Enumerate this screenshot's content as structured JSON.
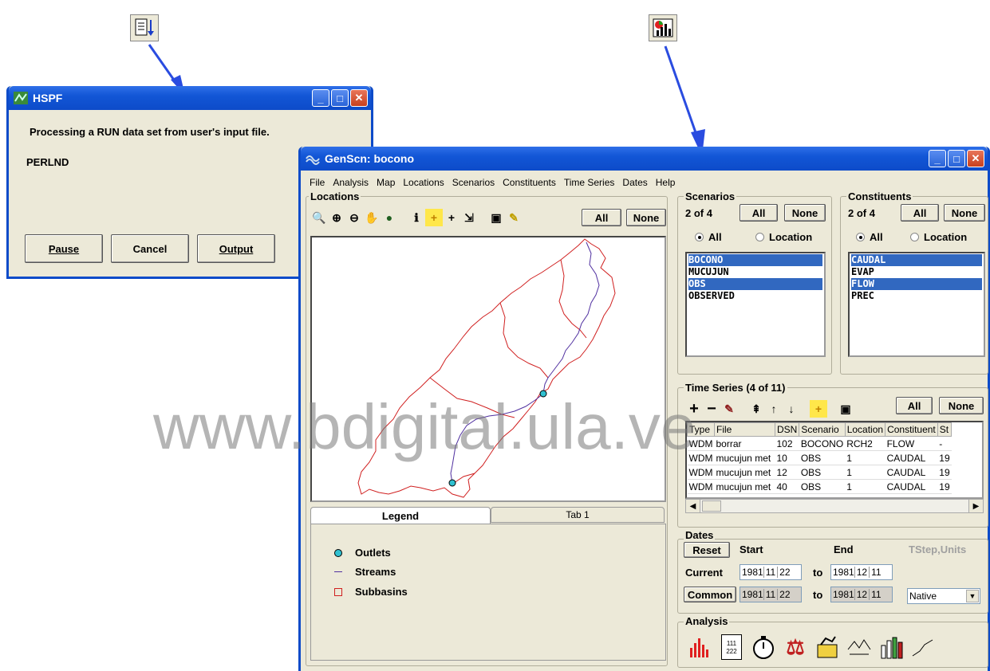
{
  "hspf": {
    "title": "HSPF",
    "message": "Processing a RUN data set from user's input file.",
    "section": "PERLND",
    "buttons": {
      "pause": "Pause",
      "cancel": "Cancel",
      "output": "Output"
    }
  },
  "watermark": "www.bdigital.ula.ve",
  "genscn": {
    "title": "GenScn: bocono",
    "menu": [
      "File",
      "Analysis",
      "Map",
      "Locations",
      "Scenarios",
      "Constituents",
      "Time Series",
      "Dates",
      "Help"
    ],
    "locations": {
      "label": "Locations",
      "all_label": "All",
      "none_label": "None"
    },
    "legend": {
      "tab_legend": "Legend",
      "tab_1": "Tab 1",
      "items": [
        {
          "label": "Outlets"
        },
        {
          "label": "Streams"
        },
        {
          "label": "Subbasins"
        }
      ]
    },
    "scenarios": {
      "label": "Scenarios",
      "count": "2 of 4",
      "all_label": "All",
      "none_label": "None",
      "radio_all": "All",
      "radio_location": "Location",
      "items": [
        {
          "name": "BOCONO",
          "selected": true
        },
        {
          "name": "MUCUJUN",
          "selected": false
        },
        {
          "name": "OBS",
          "selected": true
        },
        {
          "name": "OBSERVED",
          "selected": false
        }
      ]
    },
    "constituents": {
      "label": "Constituents",
      "count": "2 of 4",
      "all_label": "All",
      "none_label": "None",
      "radio_all": "All",
      "radio_location": "Location",
      "items": [
        {
          "name": "CAUDAL",
          "selected": true
        },
        {
          "name": "EVAP",
          "selected": false
        },
        {
          "name": "FLOW",
          "selected": true
        },
        {
          "name": "PREC",
          "selected": false
        }
      ]
    },
    "timeseries": {
      "label": "Time Series (4 of 11)",
      "all_label": "All",
      "none_label": "None",
      "columns": [
        "Type",
        "File",
        "DSN",
        "Scenario",
        "Location",
        "Constituent",
        "St"
      ],
      "rows": [
        [
          "WDM",
          "borrar",
          "102",
          "BOCONO",
          "RCH2",
          "FLOW",
          "-"
        ],
        [
          "WDM",
          "mucujun met",
          "10",
          "OBS",
          "1",
          "CAUDAL",
          "19"
        ],
        [
          "WDM",
          "mucujun met",
          "12",
          "OBS",
          "1",
          "CAUDAL",
          "19"
        ],
        [
          "WDM",
          "mucujun met",
          "40",
          "OBS",
          "1",
          "CAUDAL",
          "19"
        ]
      ]
    },
    "dates": {
      "label": "Dates",
      "reset": "Reset",
      "start": "Start",
      "end": "End",
      "tstep": "TStep,Units",
      "current": "Current",
      "common": "Common",
      "to": "to",
      "current_start": [
        "1981",
        "11",
        "22"
      ],
      "current_end": [
        "1981",
        "12",
        "11"
      ],
      "common_start": [
        "1981",
        "11",
        "22"
      ],
      "common_end": [
        "1981",
        "12",
        "11"
      ],
      "units": "Native"
    },
    "analysis": {
      "label": "Analysis",
      "list_icon_text": [
        "111",
        "222"
      ]
    }
  }
}
